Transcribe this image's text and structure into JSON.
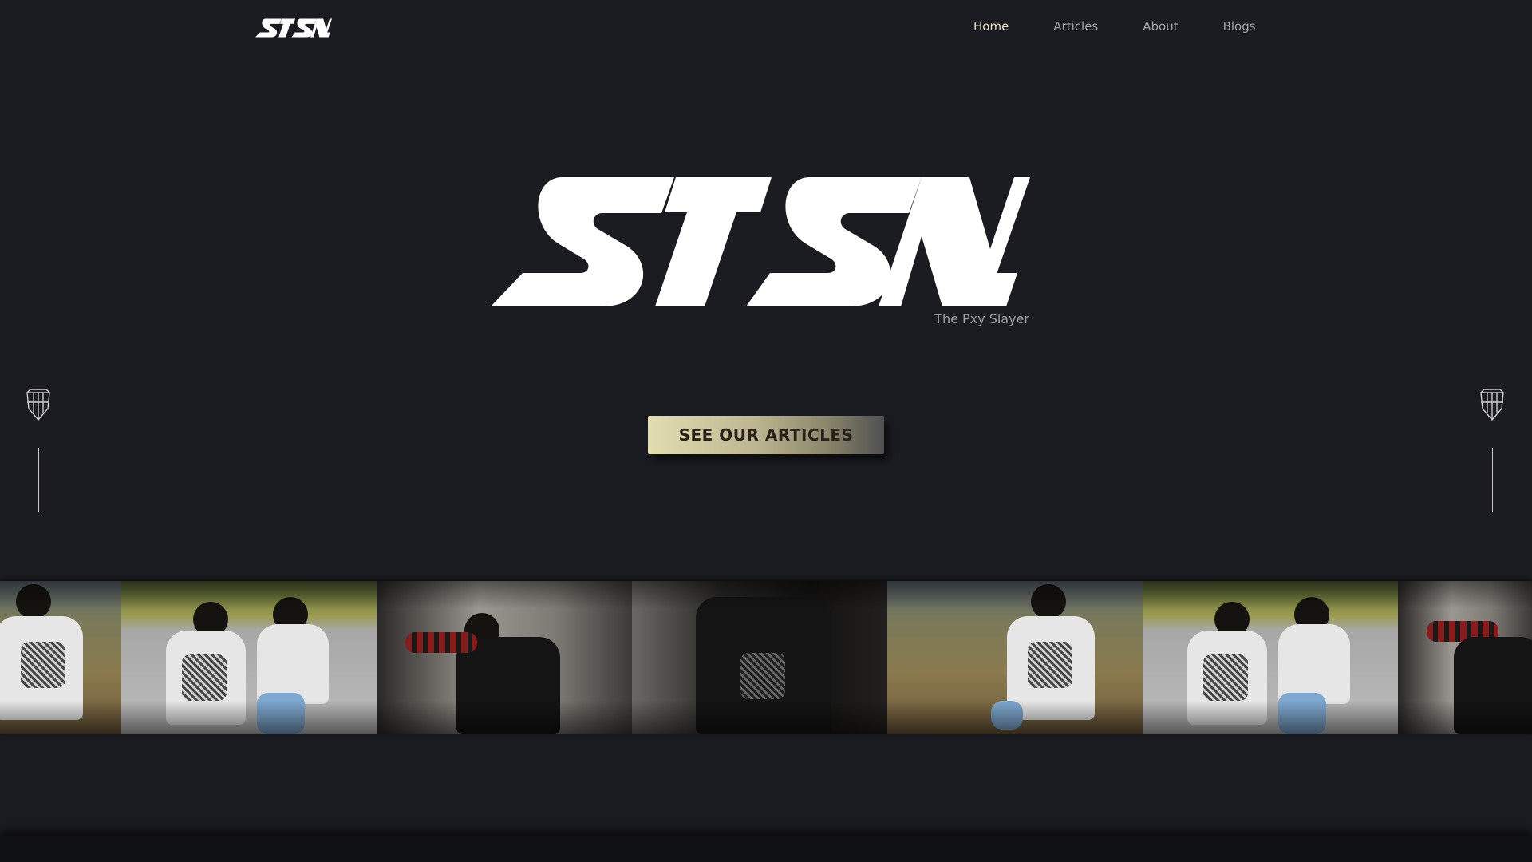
{
  "header": {
    "logo_text": "STSN.",
    "nav": [
      {
        "label": "Home",
        "active": true
      },
      {
        "label": "Articles",
        "active": false
      },
      {
        "label": "About",
        "active": false
      },
      {
        "label": "Blogs",
        "active": false
      }
    ]
  },
  "hero": {
    "logo_text": "STSN.",
    "tagline": "The Pxy Slayer",
    "cta_label": "SEE OUR ARTICLES"
  },
  "side_ornaments": {
    "icon": "shield-emblem-icon"
  },
  "gallery": {
    "photos": [
      {
        "scene": "field",
        "subject": "white-tshirt-back"
      },
      {
        "scene": "step",
        "subject": "two-white-tshirts"
      },
      {
        "scene": "wall",
        "subject": "black-hoodie-plaid-sleeve"
      },
      {
        "scene": "dark",
        "subject": "black-hoodie-print"
      },
      {
        "scene": "field",
        "subject": "white-tshirt-back"
      },
      {
        "scene": "step",
        "subject": "two-white-tshirts"
      },
      {
        "scene": "wall",
        "subject": "black-hoodie-plaid-sleeve"
      }
    ]
  },
  "colors": {
    "background": "#1b1c22",
    "nav_active": "#e8e1c6",
    "nav_inactive": "#a3a3a8",
    "cta_gradient_start": "#e2deb1",
    "cta_text": "#2a1f1a"
  }
}
